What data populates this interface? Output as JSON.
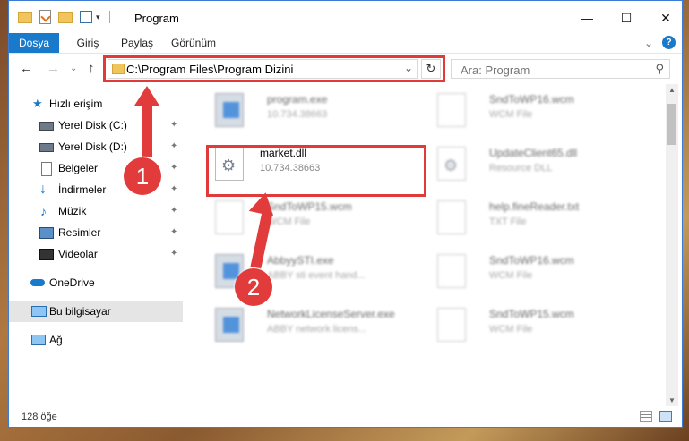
{
  "window": {
    "title": "Program",
    "controls": {
      "minimize": "—",
      "maximize": "☐",
      "close": "✕"
    }
  },
  "ribbon": {
    "tabs": [
      {
        "label": "Dosya",
        "active": true
      },
      {
        "label": "Giriş",
        "active": false
      },
      {
        "label": "Paylaş",
        "active": false
      },
      {
        "label": "Görünüm",
        "active": false
      }
    ],
    "expand_glyph": "⌄",
    "help_glyph": "?"
  },
  "nav": {
    "back_glyph": "←",
    "forward_glyph": "→",
    "recent_glyph": "⌄",
    "up_glyph": "↑",
    "address": "C:\\Program Files\\Program Dizini",
    "address_dropdown_glyph": "⌄",
    "refresh_glyph": "↻",
    "search_placeholder": "Ara: Program",
    "search_icon_glyph": "⚲"
  },
  "sidebar": {
    "items": [
      {
        "label": "Hızlı erişim",
        "icon": "star-icon",
        "pinned": false
      },
      {
        "label": "Yerel Disk (C:)",
        "icon": "drive-icon",
        "pinned": true
      },
      {
        "label": "Yerel Disk (D:)",
        "icon": "drive-icon",
        "pinned": true
      },
      {
        "label": "Belgeler",
        "icon": "documents-icon",
        "pinned": true
      },
      {
        "label": "İndirmeler",
        "icon": "download-icon",
        "pinned": true
      },
      {
        "label": "Müzik",
        "icon": "music-icon",
        "pinned": true
      },
      {
        "label": "Resimler",
        "icon": "pictures-icon",
        "pinned": true
      },
      {
        "label": "Videolar",
        "icon": "videos-icon",
        "pinned": true
      },
      {
        "label": "OneDrive",
        "icon": "cloud-icon",
        "pinned": false
      },
      {
        "label": "Bu bilgisayar",
        "icon": "computer-icon",
        "pinned": false,
        "selected": true
      },
      {
        "label": "Ağ",
        "icon": "network-icon",
        "pinned": false
      }
    ],
    "pin_glyph": "📌"
  },
  "files": [
    {
      "name": "program.exe",
      "sub": "10.734.38663",
      "type": "exe"
    },
    {
      "name": "SndToWP16.wcm",
      "sub": "WCM File",
      "type": "doc"
    },
    {
      "name": "market.dll",
      "sub": "10.734.38663",
      "type": "dll",
      "highlighted": true
    },
    {
      "name": "UpdateClient65.dll",
      "sub": "Resource DLL",
      "type": "dll"
    },
    {
      "name": "SndToWP15.wcm",
      "sub": "WCM File",
      "type": "doc"
    },
    {
      "name": "help.fineReader.txt",
      "sub": "TXT File",
      "type": "doc"
    },
    {
      "name": "AbbyySTI.exe",
      "sub": "ABBY sti event hand...",
      "type": "exe"
    },
    {
      "name": "SndToWP16.wcm",
      "sub": "WCM File",
      "type": "doc"
    },
    {
      "name": "NetworkLicenseServer.exe",
      "sub": "ABBY network licens...",
      "type": "exe"
    },
    {
      "name": "SndToWP15.wcm",
      "sub": "WCM File",
      "type": "doc"
    }
  ],
  "status": {
    "count": "128 öğe"
  },
  "annotations": {
    "step1": "1",
    "step2": "2",
    "highlight_color": "#e03a3a"
  }
}
